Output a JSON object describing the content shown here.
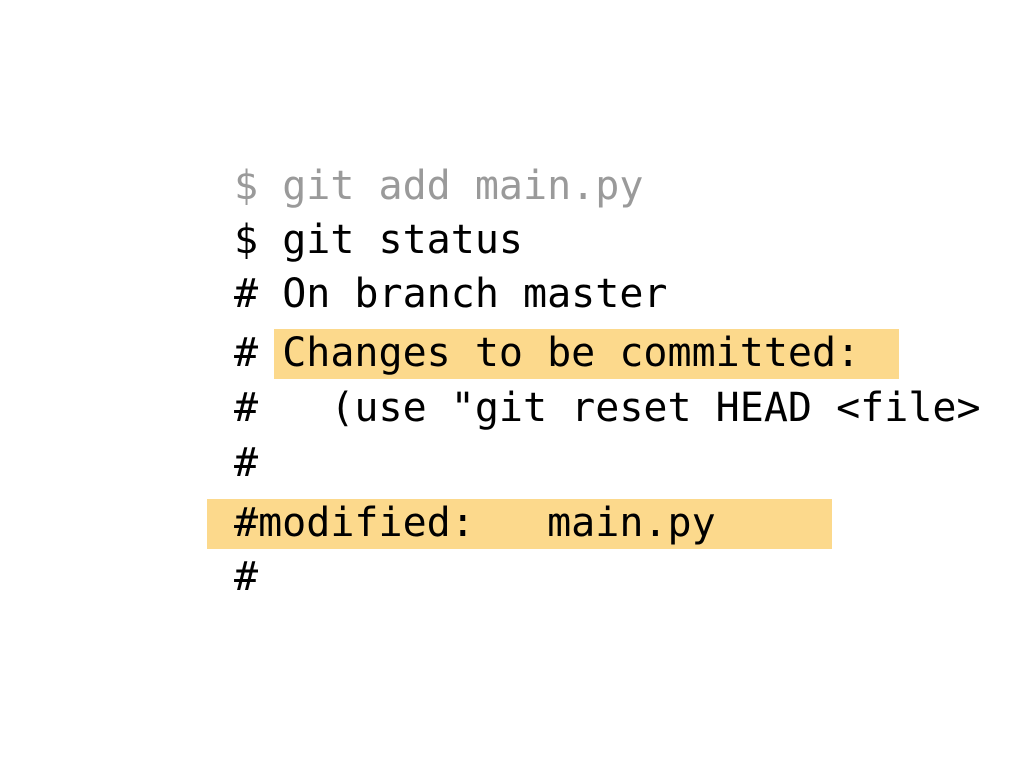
{
  "terminal": {
    "prompt": "$",
    "comment": "#",
    "lines": [
      {
        "text": "git add main.py"
      },
      {
        "text": "git status"
      },
      {
        "text": "On branch master"
      },
      {
        "text": "Changes to be committed:"
      },
      {
        "text": "  (use \"git reset HEAD <file>"
      },
      {
        "text": ""
      },
      {
        "text": "modified:   main.py"
      },
      {
        "text": ""
      }
    ]
  },
  "colors": {
    "highlight": "#fcd98c",
    "dim_text": "#9a9a9a",
    "text": "#000000"
  }
}
